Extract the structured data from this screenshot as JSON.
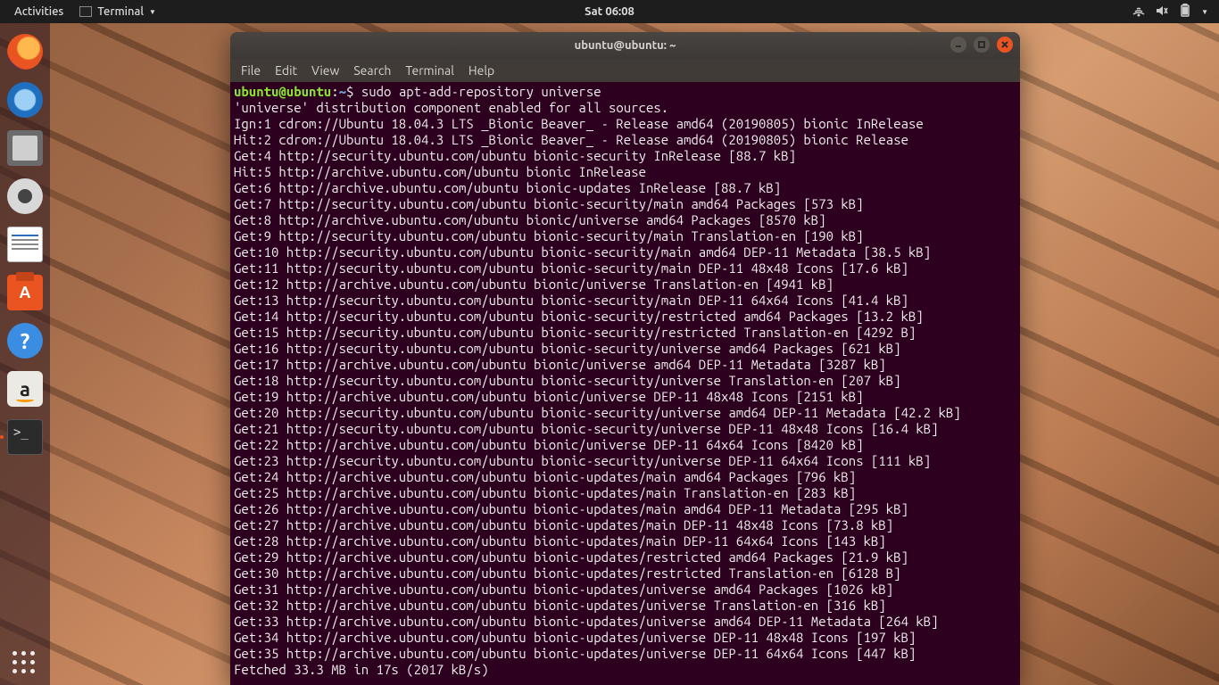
{
  "panel": {
    "activities": "Activities",
    "app_label": "Terminal",
    "clock": "Sat 06:08"
  },
  "dock": {
    "items": [
      "firefox",
      "thunderbird",
      "files",
      "rhythmbox",
      "writer",
      "software",
      "help",
      "amazon",
      "terminal"
    ]
  },
  "window": {
    "title": "ubuntu@ubuntu: ~",
    "menu": {
      "file": "File",
      "edit": "Edit",
      "view": "View",
      "search": "Search",
      "terminal": "Terminal",
      "help": "Help"
    }
  },
  "prompt": {
    "user_host": "ubuntu@ubuntu",
    "sep1": ":",
    "path": "~",
    "sigil": "$ ",
    "command": "sudo apt-add-repository universe"
  },
  "output": [
    "'universe' distribution component enabled for all sources.",
    "Ign:1 cdrom://Ubuntu 18.04.3 LTS _Bionic Beaver_ - Release amd64 (20190805) bionic InRelease",
    "Hit:2 cdrom://Ubuntu 18.04.3 LTS _Bionic Beaver_ - Release amd64 (20190805) bionic Release",
    "Get:4 http://security.ubuntu.com/ubuntu bionic-security InRelease [88.7 kB]",
    "Hit:5 http://archive.ubuntu.com/ubuntu bionic InRelease",
    "Get:6 http://archive.ubuntu.com/ubuntu bionic-updates InRelease [88.7 kB]",
    "Get:7 http://security.ubuntu.com/ubuntu bionic-security/main amd64 Packages [573 kB]",
    "Get:8 http://archive.ubuntu.com/ubuntu bionic/universe amd64 Packages [8570 kB]",
    "Get:9 http://security.ubuntu.com/ubuntu bionic-security/main Translation-en [190 kB]",
    "Get:10 http://security.ubuntu.com/ubuntu bionic-security/main amd64 DEP-11 Metadata [38.5 kB]",
    "Get:11 http://security.ubuntu.com/ubuntu bionic-security/main DEP-11 48x48 Icons [17.6 kB]",
    "Get:12 http://archive.ubuntu.com/ubuntu bionic/universe Translation-en [4941 kB]",
    "Get:13 http://security.ubuntu.com/ubuntu bionic-security/main DEP-11 64x64 Icons [41.4 kB]",
    "Get:14 http://security.ubuntu.com/ubuntu bionic-security/restricted amd64 Packages [13.2 kB]",
    "Get:15 http://security.ubuntu.com/ubuntu bionic-security/restricted Translation-en [4292 B]",
    "Get:16 http://security.ubuntu.com/ubuntu bionic-security/universe amd64 Packages [621 kB]",
    "Get:17 http://archive.ubuntu.com/ubuntu bionic/universe amd64 DEP-11 Metadata [3287 kB]",
    "Get:18 http://security.ubuntu.com/ubuntu bionic-security/universe Translation-en [207 kB]",
    "Get:19 http://archive.ubuntu.com/ubuntu bionic/universe DEP-11 48x48 Icons [2151 kB]",
    "Get:20 http://security.ubuntu.com/ubuntu bionic-security/universe amd64 DEP-11 Metadata [42.2 kB]",
    "Get:21 http://security.ubuntu.com/ubuntu bionic-security/universe DEP-11 48x48 Icons [16.4 kB]",
    "Get:22 http://archive.ubuntu.com/ubuntu bionic/universe DEP-11 64x64 Icons [8420 kB]",
    "Get:23 http://security.ubuntu.com/ubuntu bionic-security/universe DEP-11 64x64 Icons [111 kB]",
    "Get:24 http://archive.ubuntu.com/ubuntu bionic-updates/main amd64 Packages [796 kB]",
    "Get:25 http://archive.ubuntu.com/ubuntu bionic-updates/main Translation-en [283 kB]",
    "Get:26 http://archive.ubuntu.com/ubuntu bionic-updates/main amd64 DEP-11 Metadata [295 kB]",
    "Get:27 http://archive.ubuntu.com/ubuntu bionic-updates/main DEP-11 48x48 Icons [73.8 kB]",
    "Get:28 http://archive.ubuntu.com/ubuntu bionic-updates/main DEP-11 64x64 Icons [143 kB]",
    "Get:29 http://archive.ubuntu.com/ubuntu bionic-updates/restricted amd64 Packages [21.9 kB]",
    "Get:30 http://archive.ubuntu.com/ubuntu bionic-updates/restricted Translation-en [6128 B]",
    "Get:31 http://archive.ubuntu.com/ubuntu bionic-updates/universe amd64 Packages [1026 kB]",
    "Get:32 http://archive.ubuntu.com/ubuntu bionic-updates/universe Translation-en [316 kB]",
    "Get:33 http://archive.ubuntu.com/ubuntu bionic-updates/universe amd64 DEP-11 Metadata [264 kB]",
    "Get:34 http://archive.ubuntu.com/ubuntu bionic-updates/universe DEP-11 48x48 Icons [197 kB]",
    "Get:35 http://archive.ubuntu.com/ubuntu bionic-updates/universe DEP-11 64x64 Icons [447 kB]",
    "Fetched 33.3 MB in 17s (2017 kB/s)"
  ]
}
